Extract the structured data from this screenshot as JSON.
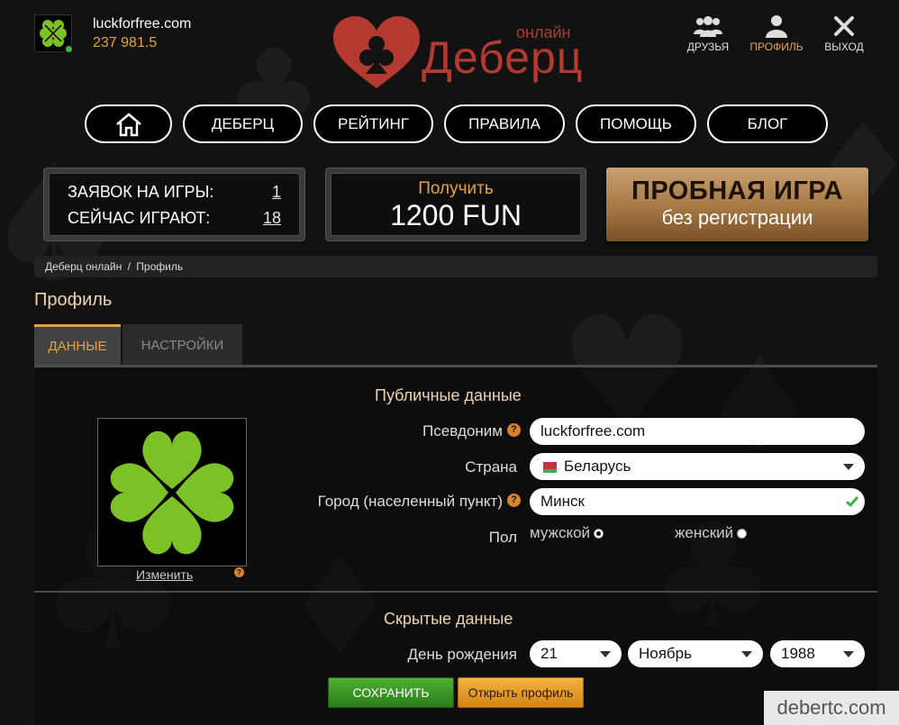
{
  "user": {
    "name": "luckforfree.com",
    "balance": "237 981.5"
  },
  "logo": {
    "brand": "Деберц",
    "subtitle": "онлайн"
  },
  "top_nav": {
    "friends": "ДРУЗЬЯ",
    "profile": "ПРОФИЛЬ",
    "logout": "ВЫХОД"
  },
  "menu": {
    "home": "home",
    "items": [
      "ДЕБЕРЦ",
      "РЕЙТИНГ",
      "ПРАВИЛА",
      "ПОМОЩЬ",
      "БЛОГ"
    ]
  },
  "stats": {
    "requests_label": "ЗАЯВОК НА ИГРЫ:",
    "requests_value": "1",
    "playing_label": "СЕЙЧАС ИГРАЮТ:",
    "playing_value": "18"
  },
  "bonus": {
    "top": "Получить",
    "amount": "1200 FUN"
  },
  "trial": {
    "title": "ПРОБНАЯ ИГРА",
    "subtitle": "без регистрации"
  },
  "breadcrumb": {
    "home": "Деберц онлайн",
    "separator": "/",
    "current": "Профиль"
  },
  "page_title": "Профиль",
  "tabs": {
    "data": "ДАННЫЕ",
    "settings": "НАСТРОЙКИ"
  },
  "public": {
    "title": "Публичные данные",
    "change_link": "Изменить",
    "nickname_label": "Псевдоним",
    "nickname_value": "luckforfree.com",
    "country_label": "Страна",
    "country_value": "Беларусь",
    "city_label": "Город (населенный пункт)",
    "city_value": "Минск",
    "gender_label": "Пол",
    "gender_male": "мужской",
    "gender_female": "женский",
    "gender_selected": "male"
  },
  "hidden": {
    "title": "Скрытые данные",
    "birthday_label": "День рождения",
    "day": "21",
    "month": "Ноябрь",
    "year": "1988"
  },
  "buttons": {
    "save": "СОХРАНИТЬ",
    "open_profile": "Открыть профиль"
  },
  "watermark": "debertc.com",
  "help_glyph": "?",
  "colors": {
    "accent": "#e3a344",
    "brand": "#b43a30",
    "clover": "#7cc227",
    "save": "#3f9a28",
    "open": "#e89a2a"
  }
}
